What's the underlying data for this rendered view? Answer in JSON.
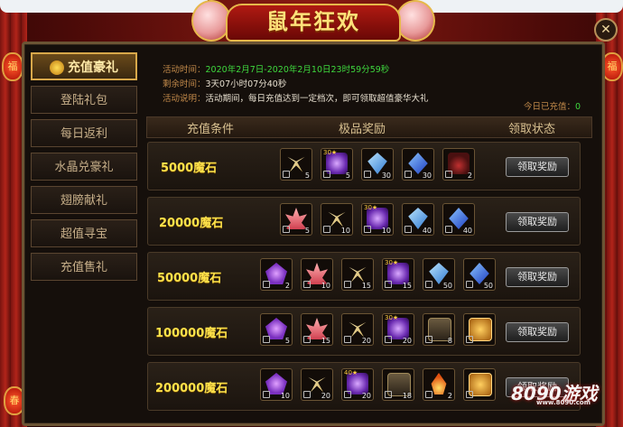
{
  "event": {
    "title": "鼠年狂欢",
    "close_icon": "close-icon"
  },
  "tabs": [
    {
      "label": "充值豪礼",
      "active": true
    },
    {
      "label": "登陆礼包",
      "active": false
    },
    {
      "label": "每日返利",
      "active": false
    },
    {
      "label": "水晶兑豪礼",
      "active": false
    },
    {
      "label": "翅膀献礼",
      "active": false
    },
    {
      "label": "超值寻宝",
      "active": false
    },
    {
      "label": "充值售礼",
      "active": false
    }
  ],
  "info": {
    "time_label": "活动时间：",
    "time_value": "2020年2月7日-2020年2月10日23时59分59秒",
    "remain_label": "剩余时间：",
    "remain_value": "3天07小时07分40秒",
    "desc_label": "活动说明：",
    "desc_value": "活动期间，每日充值达到一定档次，即可领取超值豪华大礼",
    "today_label": "今日已充值：",
    "today_value": "0"
  },
  "table": {
    "col_condition": "充值条件",
    "col_reward": "极品奖励",
    "col_status": "领取状态",
    "claim_label": "领取奖励",
    "rows": [
      {
        "condition": "5000魔石",
        "items": [
          {
            "icon": "bow-icon",
            "qty": "5",
            "lv": ""
          },
          {
            "icon": "orb-icon",
            "qty": "5",
            "lv": "30★"
          },
          {
            "icon": "crystal-blue-icon",
            "qty": "30",
            "lv": ""
          },
          {
            "icon": "crystal-dblue-icon",
            "qty": "30",
            "lv": ""
          },
          {
            "icon": "potion-icon",
            "qty": "2",
            "lv": ""
          }
        ]
      },
      {
        "condition": "20000魔石",
        "items": [
          {
            "icon": "lotus-icon",
            "qty": "5",
            "lv": ""
          },
          {
            "icon": "bow-icon",
            "qty": "10",
            "lv": ""
          },
          {
            "icon": "orb-icon",
            "qty": "10",
            "lv": "30★"
          },
          {
            "icon": "crystal-blue-icon",
            "qty": "40",
            "lv": ""
          },
          {
            "icon": "crystal-dblue-icon",
            "qty": "40",
            "lv": ""
          }
        ]
      },
      {
        "condition": "50000魔石",
        "items": [
          {
            "icon": "gem-purple-icon",
            "qty": "2",
            "lv": ""
          },
          {
            "icon": "lotus-icon",
            "qty": "10",
            "lv": ""
          },
          {
            "icon": "bow-icon",
            "qty": "15",
            "lv": ""
          },
          {
            "icon": "orb-icon",
            "qty": "15",
            "lv": "30★"
          },
          {
            "icon": "crystal-blue-icon",
            "qty": "50",
            "lv": ""
          },
          {
            "icon": "crystal-dblue-icon",
            "qty": "50",
            "lv": ""
          }
        ]
      },
      {
        "condition": "100000魔石",
        "items": [
          {
            "icon": "gem-purple-icon",
            "qty": "5",
            "lv": ""
          },
          {
            "icon": "lotus-icon",
            "qty": "15",
            "lv": ""
          },
          {
            "icon": "bow-icon",
            "qty": "20",
            "lv": ""
          },
          {
            "icon": "orb-icon",
            "qty": "20",
            "lv": "30★"
          },
          {
            "icon": "book-icon",
            "qty": "8",
            "lv": ""
          },
          {
            "icon": "box-icon",
            "qty": "",
            "lv": ""
          }
        ]
      },
      {
        "condition": "200000魔石",
        "items": [
          {
            "icon": "gem-purple-icon",
            "qty": "10",
            "lv": ""
          },
          {
            "icon": "bow-icon",
            "qty": "20",
            "lv": ""
          },
          {
            "icon": "orb-icon",
            "qty": "20",
            "lv": "40★"
          },
          {
            "icon": "book-icon",
            "qty": "18",
            "lv": ""
          },
          {
            "icon": "flame-icon",
            "qty": "2",
            "lv": ""
          },
          {
            "icon": "box-icon",
            "qty": "",
            "lv": ""
          }
        ]
      }
    ]
  },
  "watermark": {
    "text": "8090游戏",
    "sub": "www.8090.com"
  }
}
